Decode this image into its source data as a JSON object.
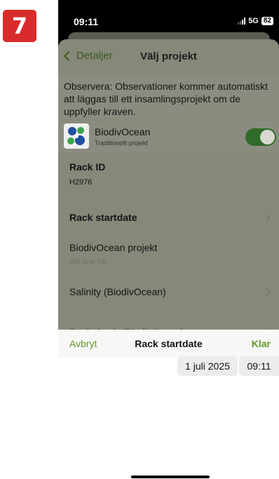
{
  "step_badge": "7",
  "status_bar": {
    "time": "09:11",
    "network": "5G",
    "battery": "82"
  },
  "nav": {
    "back_label": "Detaljer",
    "title": "Välj projekt"
  },
  "info_text": "Observera: Observationer kommer automatiskt att läggas till ett insamlingsprojekt om de uppfyller kraven.",
  "project": {
    "name": "BiodivOcean",
    "subtitle": "Traditionellt projekt",
    "enabled": true
  },
  "fields": [
    {
      "label": "Rack ID",
      "value": "H2976"
    },
    {
      "label": "Rack startdate"
    },
    {
      "label": "BiodivOcean projekt",
      "placeholder": "Ditt svar här"
    },
    {
      "label": "Salinity (BiodivOcean)"
    },
    {
      "label": "Rack depth (BiodivOcean)"
    }
  ],
  "picker": {
    "cancel_label": "Avbryt",
    "title": "Rack startdate",
    "done_label": "Klar",
    "date": "1 juli 2025",
    "time": "09:11"
  },
  "colors": {
    "accent_green": "#5e9a2a",
    "overlay": "#86887a",
    "badge_red": "#d92b2b"
  }
}
